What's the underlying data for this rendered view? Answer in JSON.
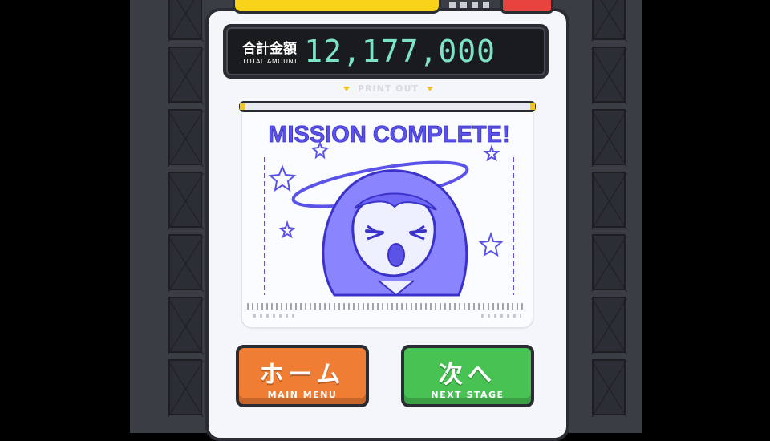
{
  "total": {
    "label_jp": "合計金額",
    "label_en": "TOTAL AMOUNT",
    "value": "12,177,000"
  },
  "print_out_label": "PRINT OUT",
  "printout": {
    "title": "MISSION COMPLETE!",
    "ink_color": "#4a3fe0"
  },
  "buttons": {
    "home_jp": "ホーム",
    "home_en": "MAIN MENU",
    "next_jp": "次へ",
    "next_en": "NEXT STAGE"
  },
  "colors": {
    "amount_digits": "#7de3c8",
    "home_button": "#f07d34",
    "next_button": "#49c254",
    "accent_yellow": "#f8d31a",
    "accent_red": "#e8443f"
  }
}
